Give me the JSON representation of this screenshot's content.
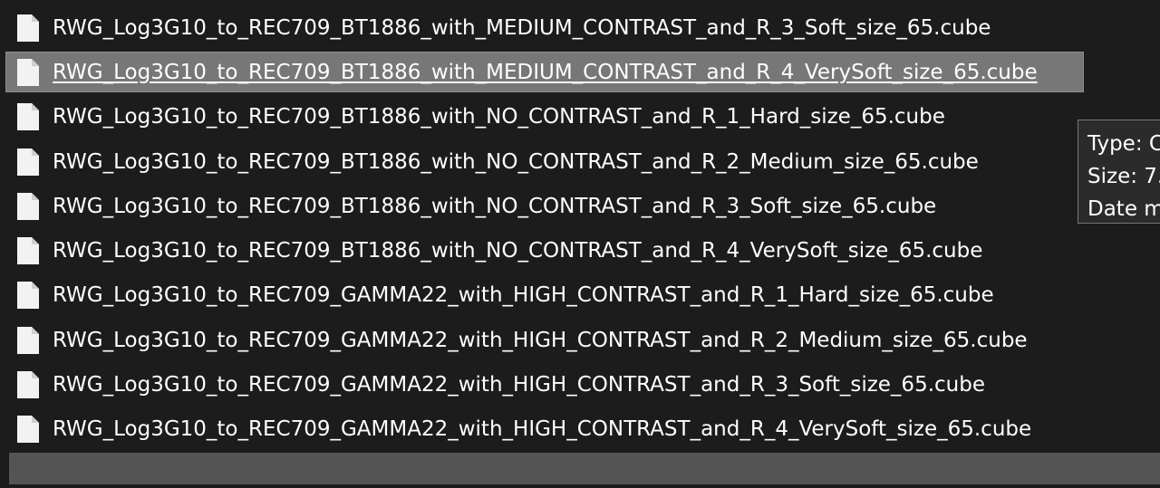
{
  "files": [
    {
      "name": "RWG_Log3G10_to_REC709_BT1886_with_MEDIUM_CONTRAST_and_R_3_Soft_size_65.cube",
      "icon": "file-icon",
      "selected": false
    },
    {
      "name": "RWG_Log3G10_to_REC709_BT1886_with_MEDIUM_CONTRAST_and_R_4_VerySoft_size_65.cube",
      "icon": "file-icon",
      "selected": true
    },
    {
      "name": "RWG_Log3G10_to_REC709_BT1886_with_NO_CONTRAST_and_R_1_Hard_size_65.cube",
      "icon": "file-icon",
      "selected": false
    },
    {
      "name": "RWG_Log3G10_to_REC709_BT1886_with_NO_CONTRAST_and_R_2_Medium_size_65.cube",
      "icon": "file-icon",
      "selected": false
    },
    {
      "name": "RWG_Log3G10_to_REC709_BT1886_with_NO_CONTRAST_and_R_3_Soft_size_65.cube",
      "icon": "file-icon",
      "selected": false
    },
    {
      "name": "RWG_Log3G10_to_REC709_BT1886_with_NO_CONTRAST_and_R_4_VerySoft_size_65.cube",
      "icon": "file-icon",
      "selected": false
    },
    {
      "name": "RWG_Log3G10_to_REC709_GAMMA22_with_HIGH_CONTRAST_and_R_1_Hard_size_65.cube",
      "icon": "file-icon",
      "selected": false
    },
    {
      "name": "RWG_Log3G10_to_REC709_GAMMA22_with_HIGH_CONTRAST_and_R_2_Medium_size_65.cube",
      "icon": "file-icon",
      "selected": false
    },
    {
      "name": "RWG_Log3G10_to_REC709_GAMMA22_with_HIGH_CONTRAST_and_R_3_Soft_size_65.cube",
      "icon": "file-icon",
      "selected": false
    },
    {
      "name": "RWG_Log3G10_to_REC709_GAMMA22_with_HIGH_CONTRAST_and_R_4_VerySoft_size_65.cube",
      "icon": "file-icon",
      "selected": false
    }
  ],
  "tooltip": {
    "type_line": "Type: C",
    "size_line": "Size: 7.",
    "date_line": "Date m"
  },
  "colors": {
    "background": "#1c1c1c",
    "selection": "#777777",
    "text": "#ffffff",
    "status_bar": "#545454"
  }
}
